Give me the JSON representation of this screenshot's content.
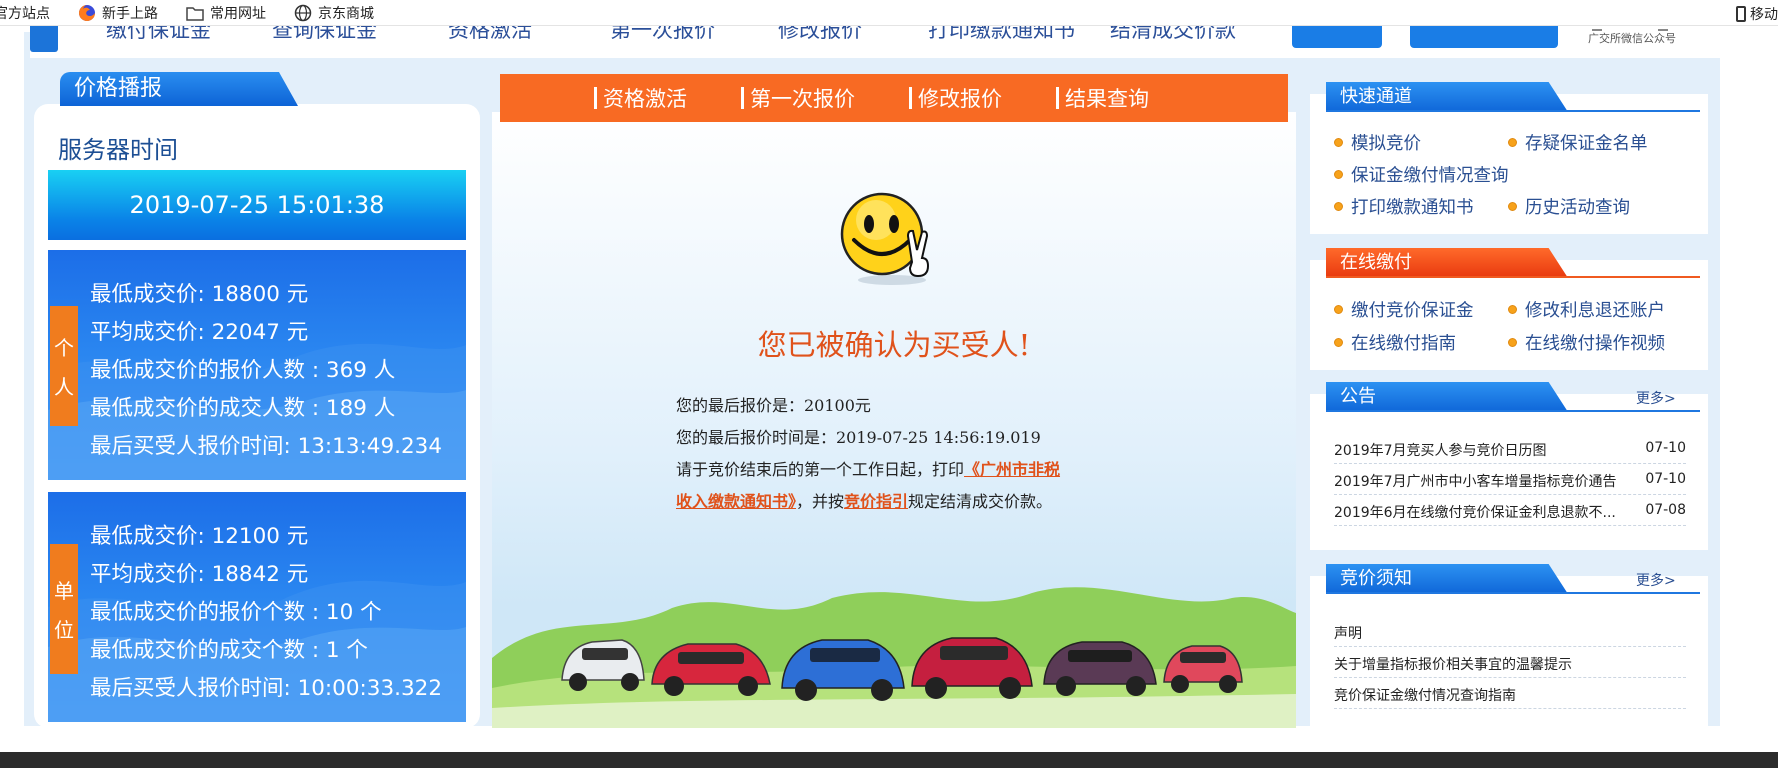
{
  "bookmarks": {
    "items": [
      "官方站点",
      "新手上路",
      "常用网址",
      "京东商城"
    ],
    "right_label": "移动"
  },
  "topnav": {
    "links": [
      "缴付保证金",
      "查询保证金",
      "资格激活",
      "第一次报价",
      "修改报价",
      "打印缴款通知书",
      "结清成交价款"
    ],
    "qr_caption": "广交所微信公众号"
  },
  "left": {
    "tab_title": "价格播报",
    "server_time_label": "服务器时间",
    "server_time": "2019-07-25 15:01:38",
    "person": {
      "tag": [
        "个",
        "人"
      ],
      "lines": [
        "最低成交价: 18800 元",
        "平均成交价:  22047 元",
        "最低成交价的报价人数 : 369 人",
        "最低成交价的成交人数 : 189 人",
        "最后买受人报价时间:  13:13:49.234"
      ]
    },
    "unit": {
      "tag": [
        "单",
        "位"
      ],
      "lines": [
        "最低成交价: 12100 元",
        "平均成交价:  18842 元",
        "最低成交价的报价个数 : 10 个",
        "最低成交价的成交个数 : 1 个",
        "最后买受人报价时间:  10:00:33.322"
      ]
    }
  },
  "middle": {
    "tabs": [
      "资格激活",
      "第一次报价",
      "修改报价",
      "结果查询"
    ],
    "confirm_title": "您已被确认为买受人!",
    "last_price_label": "您的最后报价是：20100元",
    "last_time_label": "您的最后报价时间是：2019-07-25 14:56:19.019",
    "instruction_prefix": "请于竞价结束后的第一个工作日起，打印",
    "notice_link_part1": "《广州市非税",
    "notice_link_part2": "收入缴款通知书》",
    "instruction_mid": "，并按",
    "guide_link": "竞价指引",
    "instruction_suffix": "规定结清成交价款。"
  },
  "right": {
    "quick": {
      "title": "快速通道",
      "links": [
        "模拟竞价",
        "存疑保证金名单",
        "保证金缴付情况查询",
        "打印缴款通知书",
        "历史活动查询"
      ]
    },
    "online": {
      "title": "在线缴付",
      "links": [
        "缴付竞价保证金",
        "修改利息退还账户",
        "在线缴付指南",
        "在线缴付操作视频"
      ]
    },
    "announce": {
      "title": "公告",
      "more": "更多>",
      "rows": [
        {
          "title": "2019年7月竞买人参与竞价日历图",
          "date": "07-10"
        },
        {
          "title": "2019年7月广州市中小客车增量指标竞价通告",
          "date": "07-10"
        },
        {
          "title": "2019年6月在线缴付竞价保证金利息退款不...",
          "date": "07-08"
        }
      ]
    },
    "notice": {
      "title": "竞价须知",
      "more": "更多>",
      "rows": [
        "声明",
        "关于增量指标报价相关事宜的温馨提示",
        "竞价保证金缴付情况查询指南"
      ]
    }
  }
}
